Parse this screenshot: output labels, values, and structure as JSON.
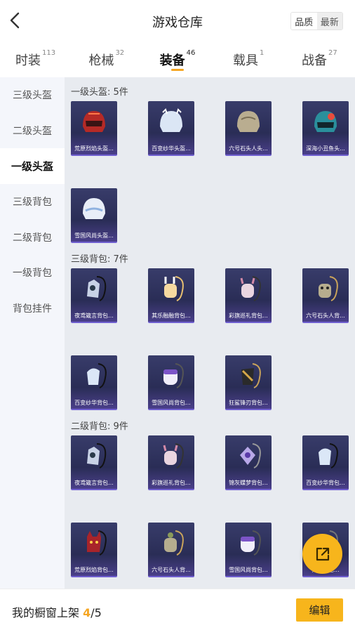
{
  "header": {
    "title": "游戏仓库",
    "sort_options": [
      "品质",
      "最新"
    ]
  },
  "tabs": [
    {
      "label": "时装",
      "count": "113"
    },
    {
      "label": "枪械",
      "count": "32"
    },
    {
      "label": "装备",
      "count": "46"
    },
    {
      "label": "载具",
      "count": "1"
    },
    {
      "label": "战备",
      "count": "27"
    }
  ],
  "active_tab": "装备",
  "sidebar": [
    "三级头盔",
    "二级头盔",
    "一级头盔",
    "三级背包",
    "二级背包",
    "一级背包",
    "背包挂件"
  ],
  "active_sidebar": "一级头盔",
  "sections": [
    {
      "title": "一级头盔: 5件",
      "items": [
        "荒原烈焰头盔...",
        "百变纱华头盔...",
        "六号石头人头...",
        "深海小丑鱼头...",
        "雪国风尚头盔..."
      ]
    },
    {
      "title": "三级背包: 7件",
      "items": [
        "夜鸢箴言背包...",
        "其乐融融背包...",
        "彩旗巡礼背包...",
        "六号石头人背...",
        "百变纱华背包...",
        "雪国风尚背包...",
        "狂鲨锋刃背包..."
      ]
    },
    {
      "title": "二级背包: 9件",
      "items": [
        "夜鸢箴言背包...",
        "彩旗巡礼背包...",
        "锦灰蝶梦背包...",
        "百变纱华背包...",
        "荒原烈焰背包...",
        "六号石头人背...",
        "雪国风尚背包...",
        "异...背包..."
      ]
    }
  ],
  "footer": {
    "shelf_label": "我的橱窗上架",
    "shelf_current": "4",
    "shelf_total": "/5",
    "edit_label": "编辑"
  },
  "colors": {
    "accent": "#f7b51c",
    "card_bg": "#2f3260",
    "card_border": "#6f5fd0",
    "side_bg": "#f4f6fb",
    "content_bg": "#e8ebf0"
  }
}
